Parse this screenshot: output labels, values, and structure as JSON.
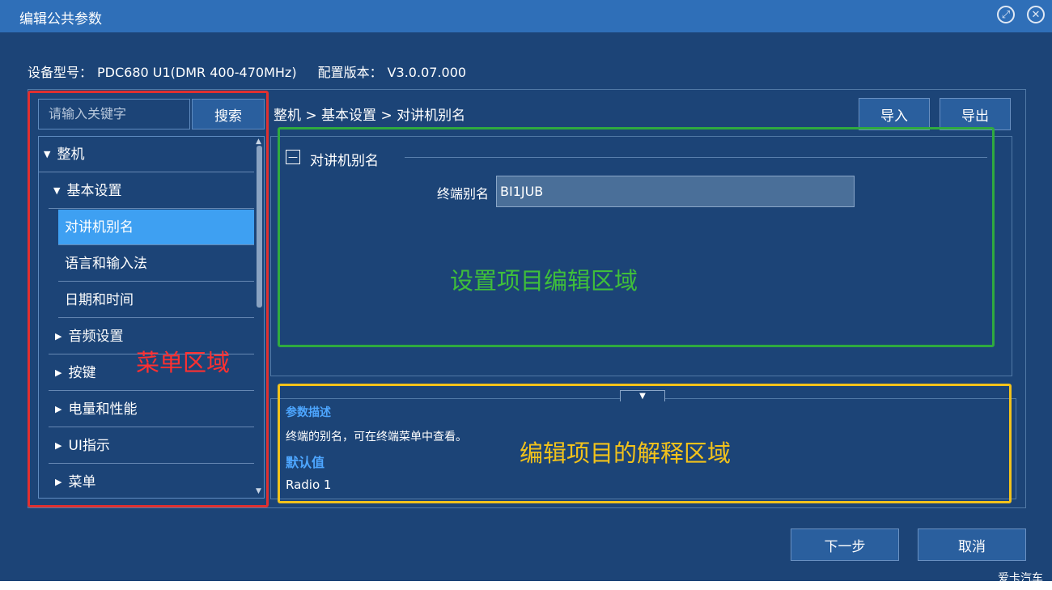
{
  "window": {
    "title": "编辑公共参数",
    "restore_icon": "restore-icon",
    "close_icon": "close-icon"
  },
  "device": {
    "model_label": "设备型号：",
    "model_value": "PDC680 U1(DMR 400-470MHz)",
    "config_label": "配置版本：",
    "config_value": "V3.0.07.000"
  },
  "search": {
    "placeholder": "请输入关键字",
    "button_label": "搜索"
  },
  "menu": {
    "items": [
      {
        "label": "整机",
        "expanded": true
      },
      {
        "label": "基本设置",
        "expanded": true
      },
      {
        "label": "对讲机别名",
        "selected": true
      },
      {
        "label": "语言和输入法"
      },
      {
        "label": "日期和时间"
      },
      {
        "label": "音频设置",
        "expanded": false
      },
      {
        "label": "按键",
        "expanded": false
      },
      {
        "label": "电量和性能",
        "expanded": false
      },
      {
        "label": "UI指示",
        "expanded": false
      },
      {
        "label": "菜单",
        "expanded": false
      }
    ]
  },
  "breadcrumb": "整机 > 基本设置 > 对讲机别名",
  "toolbar": {
    "import_label": "导入",
    "export_label": "导出"
  },
  "editor": {
    "section_title": "对讲机别名",
    "toggle_symbol": "—",
    "field_label": "终端别名",
    "field_value": "BI1JUB"
  },
  "description": {
    "heading": "参数描述",
    "text": "终端的别名，可在终端菜单中查看。",
    "default_heading": "默认值",
    "default_value": "Radio 1"
  },
  "annotations": {
    "menu_area": "菜单区域",
    "edit_area": "设置项目编辑区域",
    "explain_area": "编辑项目的解释区域",
    "red": "#e03030",
    "green": "#2faa3f",
    "yellow": "#f2c21b"
  },
  "footer": {
    "next_label": "下一步",
    "cancel_label": "取消",
    "watermark": "爱卡汽车"
  }
}
